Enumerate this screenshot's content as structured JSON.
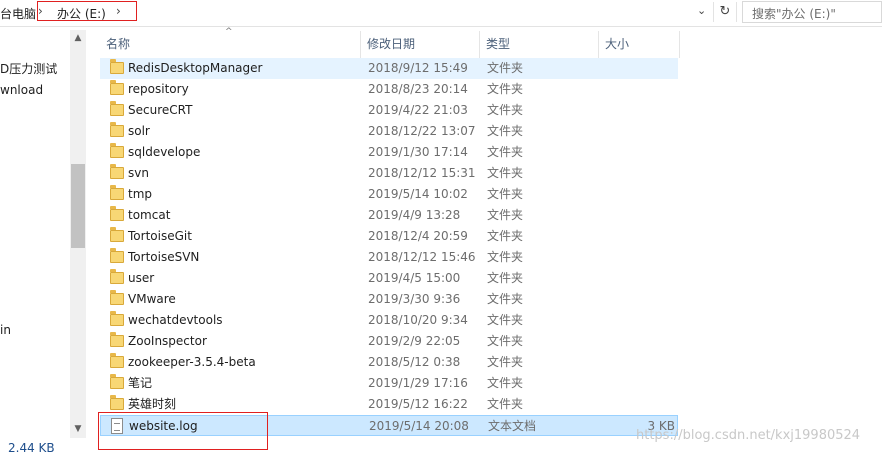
{
  "address": {
    "root_label": "台电脑",
    "drive_label": "办公 (E:)",
    "separator": "›",
    "dropdown_glyph": "⌄",
    "refresh_glyph": "↻"
  },
  "search": {
    "placeholder": "搜索\"办公 (E:)\""
  },
  "nav": {
    "items": [
      {
        "label": "D压力测试"
      },
      {
        "label": "wnload"
      },
      {
        "label": "in"
      }
    ],
    "scroll_up": "▲",
    "scroll_down": "▼"
  },
  "columns": {
    "name": "名称",
    "date": "修改日期",
    "type": "类型",
    "size": "大小",
    "sort_glyph": "^"
  },
  "files": [
    {
      "name": "RedisDesktopManager",
      "date": "2018/9/12 15:49",
      "type": "文件夹",
      "size": "",
      "kind": "folder",
      "state": "hover"
    },
    {
      "name": "repository",
      "date": "2018/8/23 20:14",
      "type": "文件夹",
      "size": "",
      "kind": "folder",
      "state": ""
    },
    {
      "name": "SecureCRT",
      "date": "2019/4/22 21:03",
      "type": "文件夹",
      "size": "",
      "kind": "folder",
      "state": ""
    },
    {
      "name": "solr",
      "date": "2018/12/22 13:07",
      "type": "文件夹",
      "size": "",
      "kind": "folder",
      "state": ""
    },
    {
      "name": "sqldevelope",
      "date": "2019/1/30 17:14",
      "type": "文件夹",
      "size": "",
      "kind": "folder",
      "state": ""
    },
    {
      "name": "svn",
      "date": "2018/12/12 15:31",
      "type": "文件夹",
      "size": "",
      "kind": "folder",
      "state": ""
    },
    {
      "name": "tmp",
      "date": "2019/5/14 10:02",
      "type": "文件夹",
      "size": "",
      "kind": "folder",
      "state": ""
    },
    {
      "name": "tomcat",
      "date": "2019/4/9 13:28",
      "type": "文件夹",
      "size": "",
      "kind": "folder",
      "state": ""
    },
    {
      "name": "TortoiseGit",
      "date": "2018/12/4 20:59",
      "type": "文件夹",
      "size": "",
      "kind": "folder",
      "state": ""
    },
    {
      "name": "TortoiseSVN",
      "date": "2018/12/12 15:46",
      "type": "文件夹",
      "size": "",
      "kind": "folder",
      "state": ""
    },
    {
      "name": "user",
      "date": "2019/4/5 15:00",
      "type": "文件夹",
      "size": "",
      "kind": "folder",
      "state": ""
    },
    {
      "name": "VMware",
      "date": "2019/3/30 9:36",
      "type": "文件夹",
      "size": "",
      "kind": "folder",
      "state": ""
    },
    {
      "name": "wechatdevtools",
      "date": "2018/10/20 9:34",
      "type": "文件夹",
      "size": "",
      "kind": "folder",
      "state": ""
    },
    {
      "name": "ZooInspector",
      "date": "2019/2/9 22:05",
      "type": "文件夹",
      "size": "",
      "kind": "folder",
      "state": ""
    },
    {
      "name": "zookeeper-3.5.4-beta",
      "date": "2018/5/12 0:38",
      "type": "文件夹",
      "size": "",
      "kind": "folder",
      "state": ""
    },
    {
      "name": "笔记",
      "date": "2019/1/29 17:16",
      "type": "文件夹",
      "size": "",
      "kind": "folder",
      "state": ""
    },
    {
      "name": "英雄时刻",
      "date": "2019/5/12 16:22",
      "type": "文件夹",
      "size": "",
      "kind": "folder",
      "state": ""
    },
    {
      "name": "website.log",
      "date": "2019/5/14 20:08",
      "type": "文本文档",
      "size": "3 KB",
      "kind": "file",
      "state": "selected"
    }
  ],
  "status": {
    "selected_size": "2.44 KB"
  },
  "watermark": "https://blog.csdn.net/kxj19980524",
  "colors": {
    "selected_bg": "#cce8ff",
    "hover_bg": "#e5f3ff",
    "highlight_box": "#e02020",
    "folder": "#f8d775"
  }
}
